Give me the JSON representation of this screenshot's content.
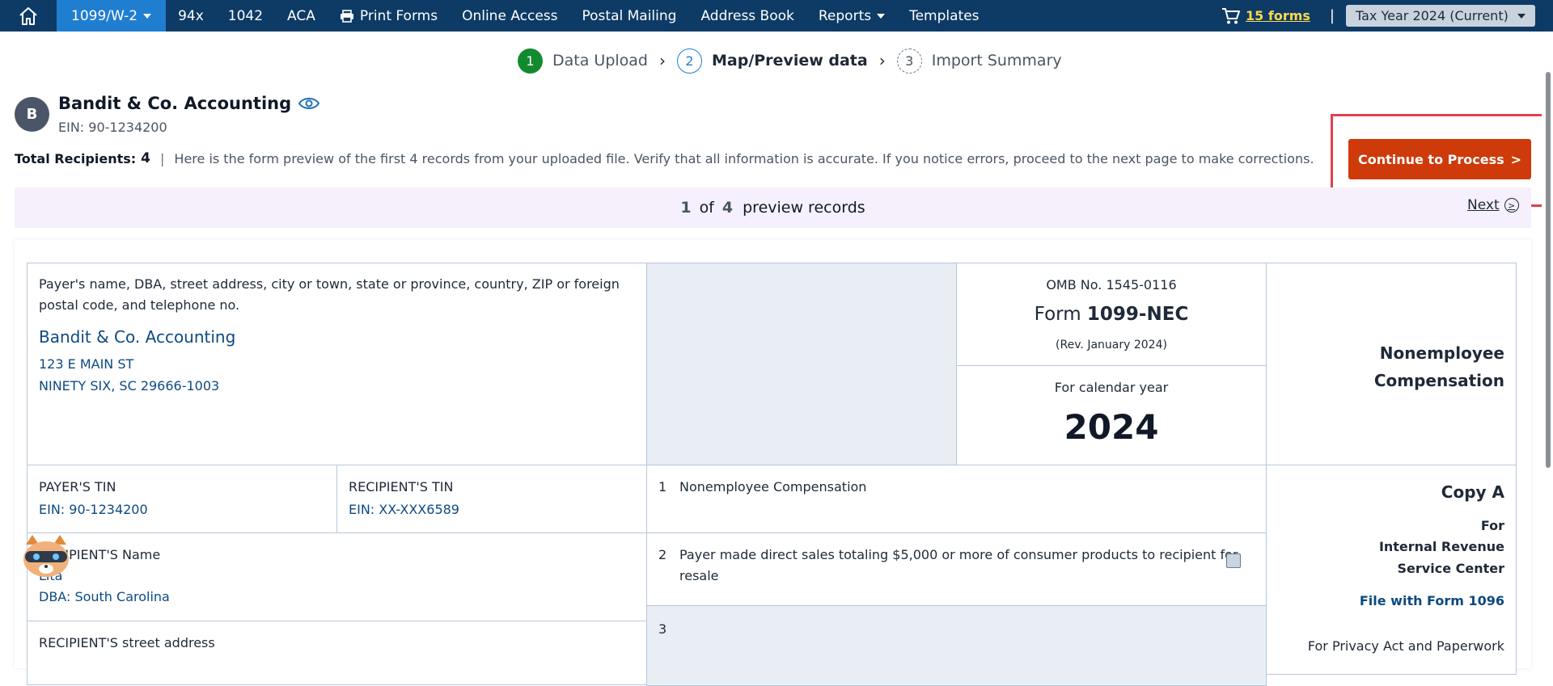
{
  "nav": {
    "items": [
      {
        "label": "1099/W-2",
        "active": true,
        "dropdown": true
      },
      {
        "label": "94x"
      },
      {
        "label": "1042"
      },
      {
        "label": "ACA"
      },
      {
        "label": "Print Forms",
        "icon": "printer-icon"
      },
      {
        "label": "Online Access"
      },
      {
        "label": "Postal Mailing"
      },
      {
        "label": "Address Book"
      },
      {
        "label": "Reports",
        "dropdown": true
      },
      {
        "label": "Templates"
      }
    ],
    "cart_label": "15 forms",
    "separator": "|",
    "tax_year": "Tax Year 2024 (Current)"
  },
  "stepper": {
    "steps": [
      {
        "num": "1",
        "label": "Data Upload"
      },
      {
        "num": "2",
        "label": "Map/Preview data"
      },
      {
        "num": "3",
        "label": "Import Summary"
      }
    ]
  },
  "company": {
    "initial": "B",
    "name": "Bandit & Co. Accounting",
    "ein": "EIN: 90-1234200"
  },
  "info": {
    "total_label": "Total Recipients:",
    "total_count": "4",
    "pipe": "|",
    "message": "Here is the form preview of the first 4 records from your uploaded file. Verify that all information is accurate. If you notice errors, proceed to the next page to make corrections."
  },
  "continue_label": "Continue to Process",
  "continue_chevron": ">",
  "preview": {
    "current": "1",
    "of": "of",
    "total": "4",
    "suffix": "preview records",
    "next": "Next",
    "next_glyph": ">"
  },
  "form": {
    "payer_label_1": "Payer's name, DBA, street address, city or town, state or province, country, ZIP or foreign",
    "payer_label_2": "postal code, and telephone no.",
    "payer_name": "Bandit & Co. Accounting",
    "payer_addr1": "123 E MAIN ST",
    "payer_addr2": "NINETY SIX, SC 29666-1003",
    "omb": "OMB No. 1545-0116",
    "form_prefix": "Form",
    "form_name": "1099-NEC",
    "rev": "(Rev. January 2024)",
    "cal_label": "For calendar year",
    "year": "2024",
    "title_1": "Nonemployee",
    "title_2": "Compensation",
    "payer_tin_label": "PAYER'S TIN",
    "payer_tin": "EIN: 90-1234200",
    "recip_tin_label": "RECIPIENT'S TIN",
    "recip_tin": "EIN: XX-XXX6589",
    "box1_num": "1",
    "box1_label": "Nonemployee Compensation",
    "copy_label": "Copy A",
    "for_label": "For",
    "irs_1": "Internal Revenue",
    "irs_2": "Service Center",
    "file_with": "File with Form 1096",
    "privacy": "For Privacy Act and Paperwork",
    "recip_name_label": "RECIPIENT'S Name",
    "recip_name": "Lita",
    "recip_dba": "DBA: South Carolina",
    "box2_num": "2",
    "box2_label_1": "Payer made direct sales totaling $5,000 or more of consumer products to recipient for",
    "box2_label_2": "resale",
    "box3_num": "3",
    "recip_street_label": "RECIPIENT'S street address"
  }
}
